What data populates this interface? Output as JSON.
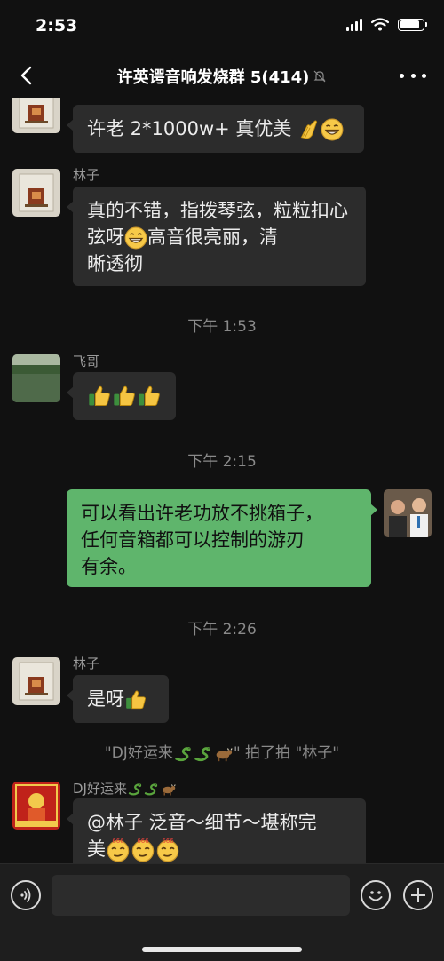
{
  "status_bar": {
    "time": "2:53"
  },
  "nav": {
    "title": "许英谔音响发烧群 5(414)"
  },
  "messages": [
    {
      "text": "许老 2*1000w+ 真优美"
    },
    {
      "sender": "林子",
      "text": "真的不错，指拨琴弦，粒粒扣心弦呀",
      "text_mid": "高音很亮丽，清",
      "text_end": "晰透彻"
    },
    {
      "timestamp": "下午 1:53"
    },
    {
      "sender": "飞哥"
    },
    {
      "timestamp": "下午 2:15"
    },
    {
      "line1": "可以看出许老功放不挑箱子，",
      "line2": "任何音箱都可以控制的游刃",
      "line3": "有余。"
    },
    {
      "timestamp": "下午 2:26"
    },
    {
      "sender": "林子",
      "text": "是呀"
    },
    {
      "system_prefix": "\"DJ好运来",
      "system_suffix": "\" 拍了拍 \"林子\""
    },
    {
      "sender": "DJ好运来",
      "line1": "@林子 泛音～细节～堪称完",
      "line2": "美"
    }
  ],
  "colors": {
    "background": "#111111",
    "bubble": "#2c2c2c",
    "mine_bubble": "#5fb56c",
    "meta_text": "#8a8a8a"
  },
  "icons": [
    "back-arrow-icon",
    "mute-bell-icon",
    "more-dots-icon",
    "thumbs-up-icon",
    "grin-icon",
    "clap-icon",
    "snake-icon",
    "ox-icon",
    "voice-icon",
    "emoji-icon",
    "plus-icon"
  ]
}
